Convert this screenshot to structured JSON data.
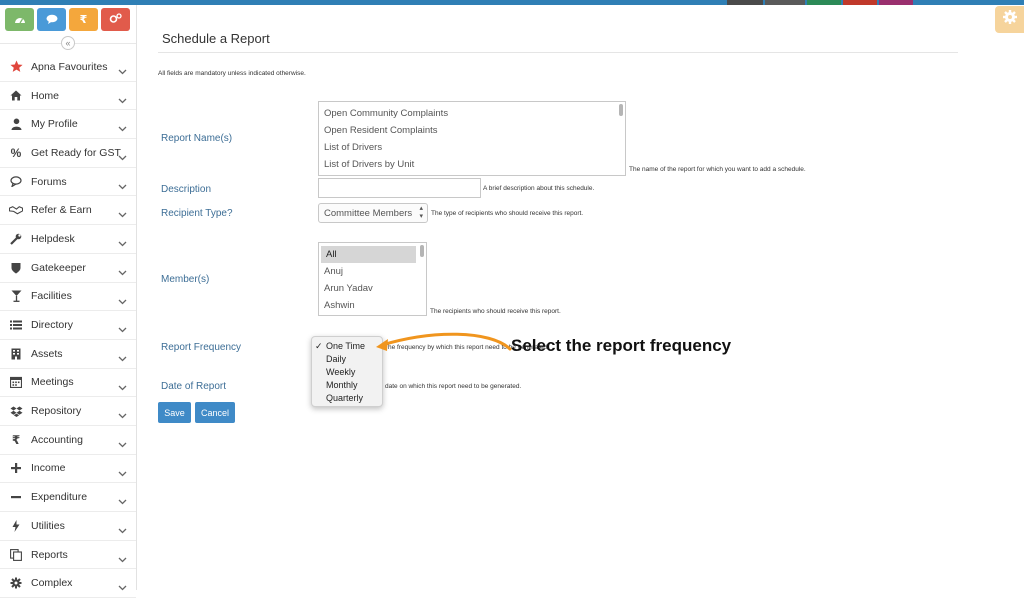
{
  "colors": {
    "accent_blue": "#3f8ac7",
    "label_blue": "#3d6e96",
    "annotation_orange": "#f0951e",
    "quick_green": "#7db86a",
    "quick_blue": "#4a9ad8",
    "quick_orange": "#f4a73c",
    "quick_red": "#e15b4b"
  },
  "quick_buttons": [
    {
      "name": "dashboard-icon"
    },
    {
      "name": "chat-icon"
    },
    {
      "name": "rupee-icon"
    },
    {
      "name": "settings-cogs-icon"
    }
  ],
  "collapse_glyph": "«",
  "sidebar": {
    "items": [
      {
        "label": "Apna Favourites",
        "icon": "star-icon"
      },
      {
        "label": "Home",
        "icon": "home-icon"
      },
      {
        "label": "My Profile",
        "icon": "user-icon"
      },
      {
        "label": "Get Ready for GST",
        "icon": "percent-icon"
      },
      {
        "label": "Forums",
        "icon": "chat-icon"
      },
      {
        "label": "Refer & Earn",
        "icon": "handshake-icon"
      },
      {
        "label": "Helpdesk",
        "icon": "wrench-icon"
      },
      {
        "label": "Gatekeeper",
        "icon": "shield-icon"
      },
      {
        "label": "Facilities",
        "icon": "glass-icon"
      },
      {
        "label": "Directory",
        "icon": "list-icon"
      },
      {
        "label": "Assets",
        "icon": "building-icon"
      },
      {
        "label": "Meetings",
        "icon": "calendar-icon"
      },
      {
        "label": "Repository",
        "icon": "dropbox-icon"
      },
      {
        "label": "Accounting",
        "icon": "rupee-icon"
      },
      {
        "label": "Income",
        "icon": "plus-icon"
      },
      {
        "label": "Expenditure",
        "icon": "minus-icon"
      },
      {
        "label": "Utilities",
        "icon": "bolt-icon"
      },
      {
        "label": "Reports",
        "icon": "copy-icon"
      },
      {
        "label": "Complex",
        "icon": "gear-icon"
      }
    ]
  },
  "page": {
    "title": "Schedule a Report",
    "mandatory_note": "All fields are mandatory unless indicated otherwise."
  },
  "form": {
    "report_names": {
      "label": "Report Name(s)",
      "options": [
        "Open Community Complaints",
        "Open Resident Complaints",
        "List of Drivers",
        "List of Drivers by Unit"
      ],
      "help": "The name of the report for which you want to add a schedule."
    },
    "description": {
      "label": "Description",
      "value": "",
      "help": "A brief description about this schedule."
    },
    "recipient_type": {
      "label": "Recipient Type?",
      "value": "Committee Members",
      "help": "The type of recipients who should receive this report."
    },
    "members": {
      "label": "Member(s)",
      "options": [
        "All",
        "Anuj",
        "Arun Yadav",
        "Ashwin"
      ],
      "selected": "All",
      "help": "The recipients who should receive this report."
    },
    "report_frequency": {
      "label": "Report Frequency",
      "options": [
        "One Time",
        "Daily",
        "Weekly",
        "Monthly",
        "Quarterly"
      ],
      "selected": "One Time",
      "help_prefix": "The frequency by which this report need",
      "help_suffix": "to be generated."
    },
    "date_of_report": {
      "label": "Date of Report",
      "help_visible": "date on which this report need to be generated."
    }
  },
  "buttons": {
    "save": "Save",
    "cancel": "Cancel"
  },
  "annotation": {
    "text": "Select the report frequency"
  }
}
